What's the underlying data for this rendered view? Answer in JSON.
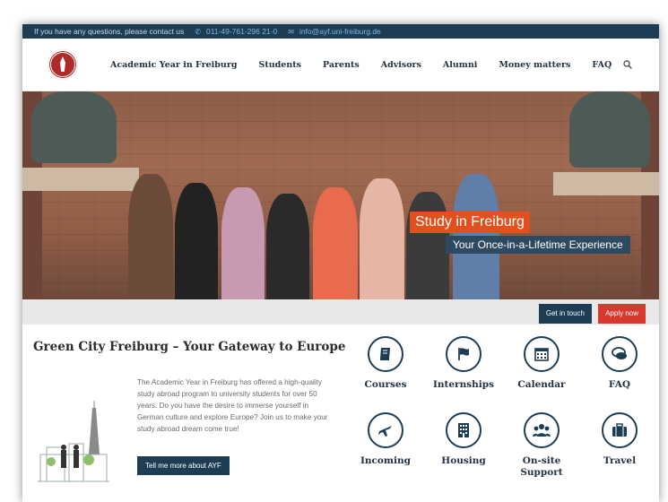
{
  "topbar": {
    "contact_text": "If you have any questions, please contact us",
    "phone": "011-49-761-296 21-0",
    "email": "info@ayf.uni-freiburg.de"
  },
  "nav": {
    "items": [
      "Academic Year in Freiburg",
      "Students",
      "Parents",
      "Advisors",
      "Alumni",
      "Money matters",
      "FAQ"
    ]
  },
  "hero": {
    "title": "Study in Freiburg",
    "subtitle": "Your Once-in-a-Lifetime Experience"
  },
  "cta": {
    "touch_label": "Get in touch",
    "apply_label": "Apply now"
  },
  "intro": {
    "heading": "Green City Freiburg – Your Gateway to Europe",
    "body": "The Academic Year in Freiburg has offered a high-quality study abroad program to university students for over 50 years. Do you have the desire to immerse yourself in German culture and explore Europe? Join us to make your study abroad dream come true!",
    "button_label": "Tell me more about AYF"
  },
  "tiles": [
    {
      "label": "Courses",
      "icon": "book-icon"
    },
    {
      "label": "Internships",
      "icon": "flag-icon"
    },
    {
      "label": "Calendar",
      "icon": "calendar-icon"
    },
    {
      "label": "FAQ",
      "icon": "chat-icon"
    },
    {
      "label": "Incoming",
      "icon": "plane-icon"
    },
    {
      "label": "Housing",
      "icon": "building-icon"
    },
    {
      "label": "On-site Support",
      "icon": "group-icon"
    },
    {
      "label": "Travel",
      "icon": "suitcase-icon"
    }
  ],
  "colors": {
    "navy": "#1d3d55",
    "accent_orange": "#e1501f",
    "apply_red": "#d63a2e"
  }
}
